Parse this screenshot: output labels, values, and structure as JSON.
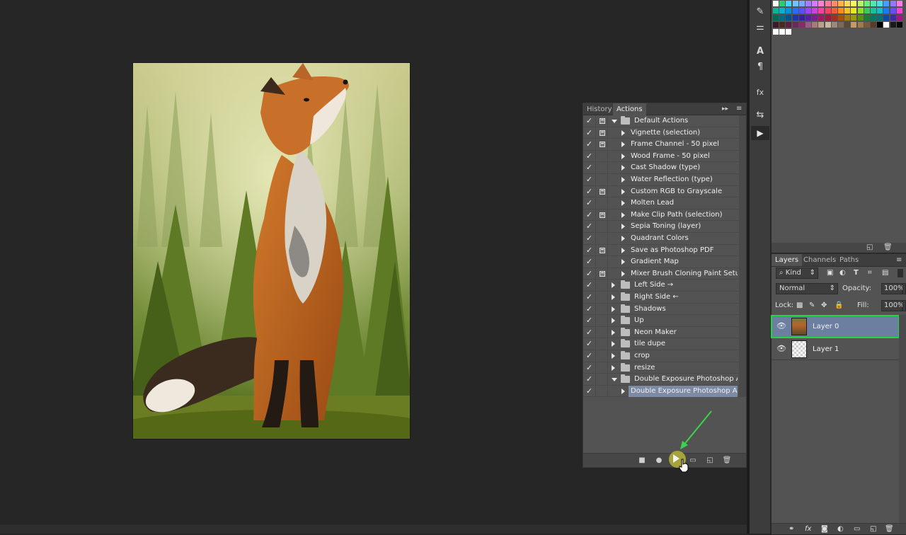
{
  "actions_panel": {
    "tabs": [
      "History",
      "Actions"
    ],
    "active_tab": "Actions",
    "rows": [
      {
        "label": "Default Actions",
        "type": "set",
        "expanded": true,
        "dialog": true,
        "checked": true
      },
      {
        "label": "Vignette (selection)",
        "type": "action",
        "dialog": true,
        "checked": true
      },
      {
        "label": "Frame Channel - 50 pixel",
        "type": "action",
        "dialog": true,
        "checked": true
      },
      {
        "label": "Wood Frame - 50 pixel",
        "type": "action",
        "dialog": false,
        "checked": true
      },
      {
        "label": "Cast Shadow (type)",
        "type": "action",
        "dialog": false,
        "checked": true
      },
      {
        "label": "Water Reflection (type)",
        "type": "action",
        "dialog": false,
        "checked": true
      },
      {
        "label": "Custom RGB to Grayscale",
        "type": "action",
        "dialog": true,
        "checked": true
      },
      {
        "label": "Molten Lead",
        "type": "action",
        "dialog": false,
        "checked": true
      },
      {
        "label": "Make Clip Path (selection)",
        "type": "action",
        "dialog": true,
        "checked": true
      },
      {
        "label": "Sepia Toning (layer)",
        "type": "action",
        "dialog": false,
        "checked": true
      },
      {
        "label": "Quadrant Colors",
        "type": "action",
        "dialog": false,
        "checked": true
      },
      {
        "label": "Save as Photoshop PDF",
        "type": "action",
        "dialog": true,
        "checked": true
      },
      {
        "label": "Gradient Map",
        "type": "action",
        "dialog": false,
        "checked": true
      },
      {
        "label": "Mixer Brush Cloning Paint Setup",
        "type": "action",
        "dialog": true,
        "checked": true
      },
      {
        "label": "Left Side →",
        "type": "set",
        "expanded": false,
        "dialog": false,
        "checked": true
      },
      {
        "label": "Right Side ←",
        "type": "set",
        "expanded": false,
        "dialog": false,
        "checked": true
      },
      {
        "label": "Shadows",
        "type": "set",
        "expanded": false,
        "dialog": false,
        "checked": true
      },
      {
        "label": "Up",
        "type": "set",
        "expanded": false,
        "dialog": false,
        "checked": true
      },
      {
        "label": "Neon Maker",
        "type": "set",
        "expanded": false,
        "dialog": false,
        "checked": true
      },
      {
        "label": "tile dupe",
        "type": "set",
        "expanded": false,
        "dialog": false,
        "checked": true
      },
      {
        "label": "crop",
        "type": "set",
        "expanded": false,
        "dialog": false,
        "checked": true
      },
      {
        "label": "resize",
        "type": "set",
        "expanded": false,
        "dialog": false,
        "checked": true
      },
      {
        "label": "Double Exposure Photoshop Acti...",
        "type": "set",
        "expanded": true,
        "dialog": false,
        "checked": true
      },
      {
        "label": "Double Exposure Photoshop Acti...",
        "type": "action",
        "dialog": false,
        "checked": true,
        "selected": true
      }
    ],
    "footer_icons": [
      "stop-icon",
      "record-icon",
      "play-icon",
      "new-set-icon",
      "new-action-icon",
      "delete-icon"
    ]
  },
  "layers_panel": {
    "tabs": [
      "Layers",
      "Channels",
      "Paths"
    ],
    "active_tab": "Layers",
    "filter_kind": "Kind",
    "blend_mode": "Normal",
    "opacity_label": "Opacity:",
    "opacity_value": "100%",
    "lock_label": "Lock:",
    "fill_label": "Fill:",
    "fill_value": "100%",
    "layers": [
      {
        "name": "Layer 0",
        "selected": true,
        "visible": true
      },
      {
        "name": "Layer 1",
        "selected": false,
        "visible": true
      }
    ]
  },
  "swatch_colors": [
    [
      "#ffffff",
      "#2ecc71",
      "#4ad2ff",
      "#73c2ff",
      "#7aa8ff",
      "#a37eff",
      "#d47cff",
      "#ff80d0",
      "#ff7a9b",
      "#ff8c6b",
      "#ffb050",
      "#ffd75a",
      "#f6f86a",
      "#b6f26c",
      "#6bec7e",
      "#4fe8b2",
      "#47e0e8",
      "#4a9dff",
      "#8f7aff",
      "#ff7ae0"
    ],
    [
      "#00b894",
      "#00b3d6",
      "#0091e6",
      "#2a6bff",
      "#5c4cff",
      "#9a45ff",
      "#d03fe3",
      "#ff3e9f",
      "#ff3f63",
      "#ff5a36",
      "#ff8c1a",
      "#ffc21a",
      "#e7ea1f",
      "#8fe02a",
      "#2fd15a",
      "#16c49c",
      "#10bfc9",
      "#1c78ff",
      "#6a4cff",
      "#ff3ed7"
    ],
    [
      "#006b52",
      "#006a80",
      "#00548a",
      "#1838a6",
      "#3422a3",
      "#5a1ea6",
      "#7e1b8f",
      "#a0185e",
      "#a3183a",
      "#a3301b",
      "#a65310",
      "#a87b0d",
      "#98990e",
      "#5a8f14",
      "#178032",
      "#0a7560",
      "#0a7078",
      "#0d4aa6",
      "#3d2aa6",
      "#a0188a"
    ],
    [
      "#3a1a2a",
      "#4a2a1a",
      "#5a1f3f",
      "#6a2a5a",
      "#8a2a6a",
      "#9a5a8a",
      "#aa7a7a",
      "#baa08a",
      "#c9b9a0",
      "#9a8a7a",
      "#7a6a5a",
      "#5a4a3a",
      "#c49a6a",
      "#a07a4a",
      "#7a5a3a",
      "#5a3a2a",
      "#000000",
      "#ffffff",
      "#1a1a1a",
      "#0a0a0a"
    ],
    [
      "#ffffff",
      "#ffffff",
      "#ffffff"
    ]
  ],
  "strip_icons": [
    "brush-presets-icon",
    "adjust-sliders-icon",
    "character-icon",
    "paragraph-icon",
    "styles-icon",
    "history-brush-icon",
    "actions-play-icon"
  ],
  "canvas": {
    "description": "fox-in-forest"
  }
}
